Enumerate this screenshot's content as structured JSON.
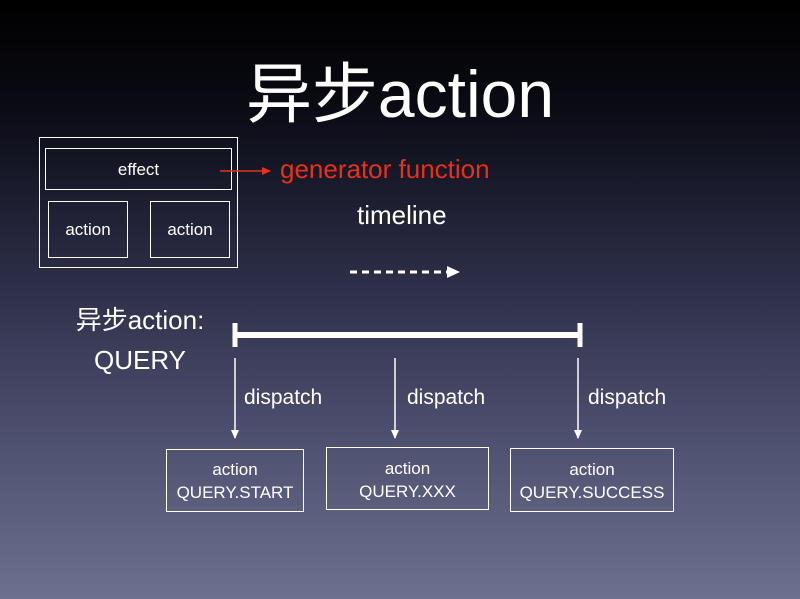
{
  "title": "异步action",
  "effect_diagram": {
    "effect_label": "effect",
    "action_left_label": "action",
    "action_right_label": "action"
  },
  "generator_label": "generator function",
  "timeline_label": "timeline",
  "async_action": {
    "line1": "异步action:",
    "line2": "QUERY"
  },
  "dispatch_labels": [
    "dispatch",
    "dispatch",
    "dispatch"
  ],
  "action_boxes": [
    {
      "line1": "action",
      "line2": "QUERY.START"
    },
    {
      "line1": "action",
      "line2": "QUERY.XXX"
    },
    {
      "line1": "action",
      "line2": "QUERY.SUCCESS"
    }
  ],
  "colors": {
    "accent_red": "#e8301c",
    "foreground": "#ffffff"
  }
}
